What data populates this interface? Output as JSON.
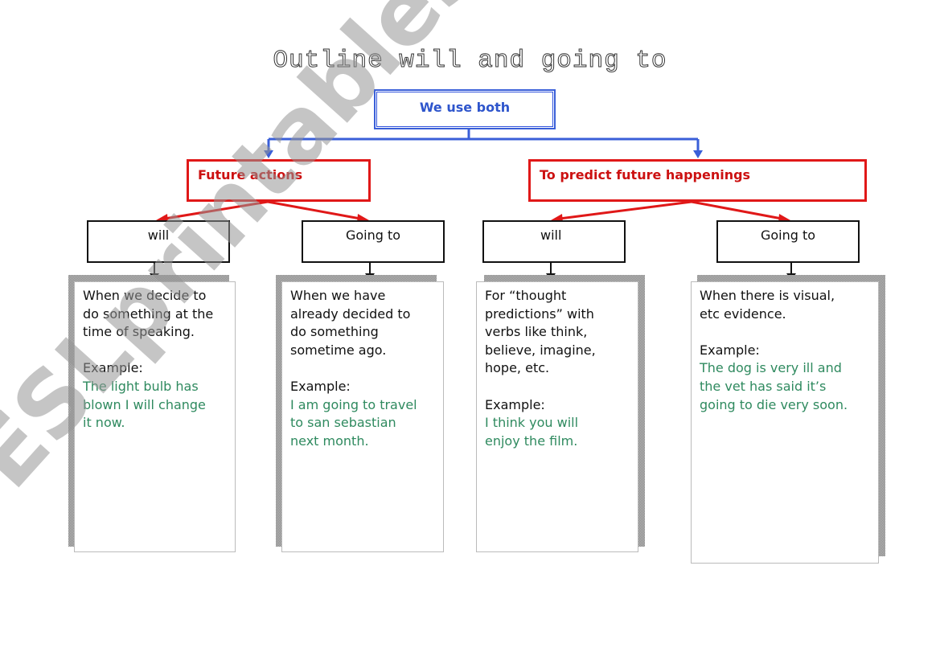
{
  "title": "Outline will and going to",
  "root": {
    "label": "We use both"
  },
  "branches": [
    {
      "label": "Future actions",
      "children": [
        {
          "label": "will",
          "description": [
            "When we decide to",
            "do something at the",
            "time of speaking."
          ],
          "example_label": "Example:",
          "example": [
            "The light bulb has",
            "blown I will change",
            "it now."
          ]
        },
        {
          "label": "Going to",
          "description": [
            "When we have",
            "already decided to",
            "do something",
            "sometime ago."
          ],
          "example_label": "Example:",
          "example": [
            "I am going to travel",
            "to san sebastian",
            "next month."
          ]
        }
      ]
    },
    {
      "label": "To predict future happenings",
      "children": [
        {
          "label": "will",
          "description": [
            "For “thought",
            "predictions” with",
            "verbs like think,",
            "believe, imagine,",
            "hope, etc."
          ],
          "example_label": "Example:",
          "example": [
            "I think you will",
            "enjoy the film."
          ]
        },
        {
          "label": "Going to",
          "description": [
            "When there is visual,",
            "etc evidence."
          ],
          "example_label": "Example:",
          "example": [
            "The dog is very ill and",
            "the vet has said it’s",
            "going to die very soon."
          ]
        }
      ]
    }
  ],
  "watermark": "ESLprintables.com",
  "colors": {
    "root_blue": "#3355dd",
    "branch_red": "#e01818",
    "example_green": "#2f8a5f"
  }
}
